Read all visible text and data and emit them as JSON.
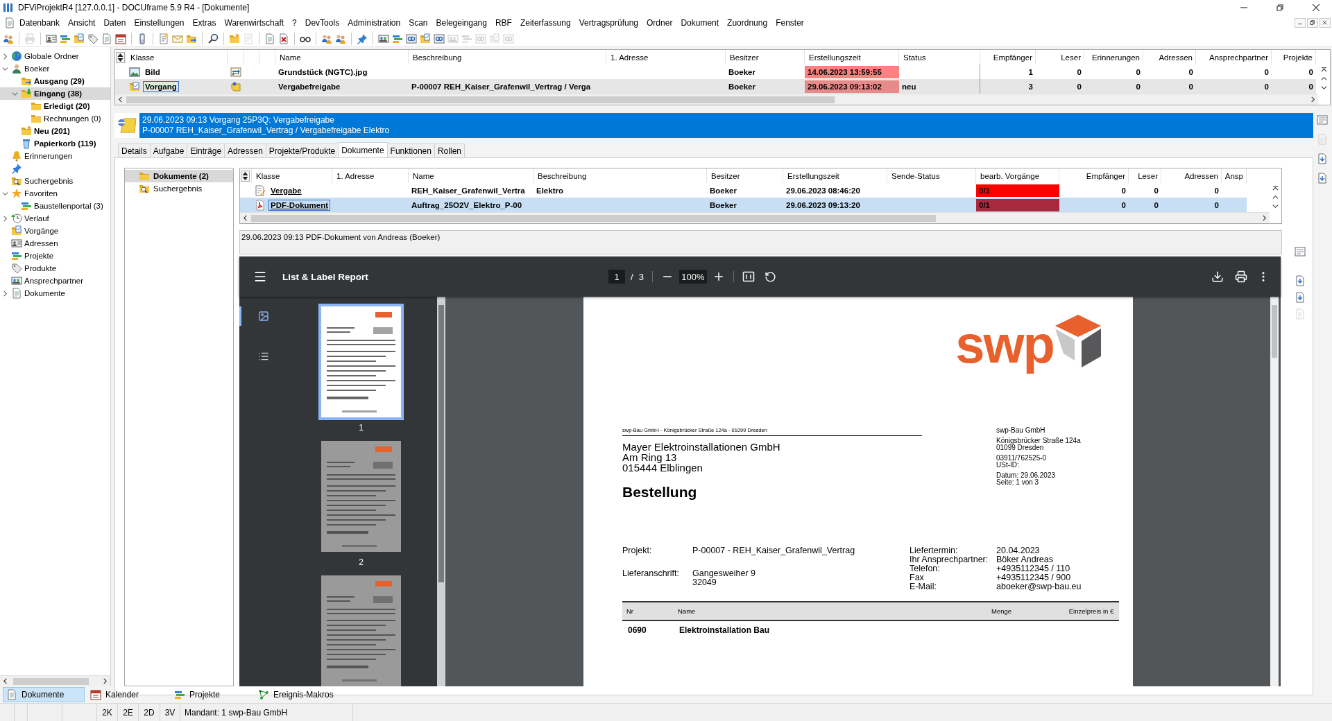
{
  "window": {
    "title": "DFViProjektR4 [127.0.0.1] - DOCUframe 5.9 R4 - [Dokumente]"
  },
  "menu": [
    "Datenbank",
    "Ansicht",
    "Daten",
    "Einstellungen",
    "Extras",
    "Warenwirtschaft",
    "?",
    "DevTools",
    "Administration",
    "Scan",
    "Belegeingang",
    "RBF",
    "Zeiterfassung",
    "Vertragsprüfung",
    "Ordner",
    "Dokument",
    "Zuordnung",
    "Fenster"
  ],
  "toolbar": [
    [
      {
        "kind": "people",
        "disabled": false
      }
    ],
    [
      {
        "kind": "printer",
        "disabled": true
      }
    ],
    [
      {
        "kind": "card",
        "disabled": false
      },
      {
        "kind": "stack",
        "disabled": false
      },
      {
        "kind": "checklist",
        "disabled": false
      },
      {
        "kind": "tag",
        "disabled": false
      },
      {
        "kind": "page",
        "disabled": false
      },
      {
        "kind": "calendar",
        "disabled": false
      }
    ],
    [
      {
        "kind": "phone",
        "disabled": false
      }
    ],
    [
      {
        "kind": "note",
        "disabled": false
      },
      {
        "kind": "envelope",
        "disabled": false
      },
      {
        "kind": "folder-out",
        "disabled": false
      }
    ],
    [
      {
        "kind": "magnifier",
        "disabled": false
      }
    ],
    [
      {
        "kind": "folder-new",
        "disabled": false
      },
      {
        "kind": "note",
        "disabled": true
      }
    ],
    [
      {
        "kind": "page",
        "disabled": false
      },
      {
        "kind": "doc-x",
        "disabled": false
      }
    ],
    [
      {
        "kind": "glasses",
        "disabled": false
      }
    ],
    [
      {
        "kind": "people",
        "disabled": false
      },
      {
        "kind": "people",
        "disabled": false
      }
    ],
    [
      {
        "kind": "pin",
        "disabled": false
      }
    ],
    [
      {
        "kind": "contacts",
        "disabled": false
      },
      {
        "kind": "stack",
        "disabled": false
      },
      {
        "kind": "link",
        "disabled": false
      },
      {
        "kind": "checklist",
        "disabled": false
      },
      {
        "kind": "link",
        "disabled": false
      },
      {
        "kind": "contacts",
        "disabled": true
      },
      {
        "kind": "stack",
        "disabled": true
      },
      {
        "kind": "link",
        "disabled": true
      },
      {
        "kind": "checklist",
        "disabled": true
      },
      {
        "kind": "link",
        "disabled": true
      }
    ]
  ],
  "tree": [
    {
      "label": "Globale Ordner",
      "kind": "globe",
      "expanded": false,
      "selected": false,
      "unread": false
    },
    {
      "label": "Boeker",
      "kind": "person",
      "expanded": true,
      "selected": false,
      "unread": false,
      "children": [
        {
          "label": "Ausgang (29)",
          "kind": "folder-out",
          "selected": false,
          "unread": true
        },
        {
          "label": "Eingang (38)",
          "kind": "folder-in",
          "expanded": true,
          "selected": true,
          "unread": true,
          "children": [
            {
              "label": "Erledigt (20)",
              "kind": "folder",
              "selected": false,
              "unread": true
            },
            {
              "label": "Rechnungen (0)",
              "kind": "folder",
              "selected": false,
              "unread": false
            }
          ]
        },
        {
          "label": "Neu (201)",
          "kind": "folder-new",
          "selected": false,
          "unread": true
        },
        {
          "label": "Papierkorb (119)",
          "kind": "bin",
          "selected": false,
          "unread": true
        }
      ]
    },
    {
      "label": "Erinnerungen",
      "kind": "bell",
      "selected": false,
      "unread": false
    },
    {
      "kind": "pin",
      "selected": false
    },
    {
      "label": "Suchergebnis",
      "kind": "search-folder",
      "selected": false,
      "unread": false
    },
    {
      "label": "Favoriten",
      "kind": "star",
      "expanded": true,
      "selected": false,
      "unread": false,
      "children": [
        {
          "label": "Baustellenportal (3)",
          "kind": "stack",
          "selected": false,
          "unread": false
        }
      ]
    },
    {
      "label": "Verlauf",
      "kind": "clock",
      "expanded": false,
      "selected": false,
      "unread": false
    },
    {
      "label": "Vorgänge",
      "kind": "checklist",
      "selected": false,
      "unread": false
    },
    {
      "label": "Adressen",
      "kind": "card",
      "selected": false,
      "unread": false
    },
    {
      "label": "Projekte",
      "kind": "stack",
      "selected": false,
      "unread": false
    },
    {
      "label": "Produkte",
      "kind": "tag",
      "selected": false,
      "unread": false
    },
    {
      "label": "Ansprechpartner",
      "kind": "contacts",
      "selected": false,
      "unread": false
    },
    {
      "label": "Dokumente",
      "kind": "page",
      "expanded": false,
      "selected": false,
      "unread": false
    }
  ],
  "items_table": {
    "columns": [
      {
        "label": "Klasse",
        "kind": "class"
      },
      {
        "label": "Name",
        "kind": "text"
      },
      {
        "label": "Beschreibung",
        "kind": "text"
      },
      {
        "label": "1. Adresse",
        "kind": "text"
      },
      {
        "label": "Besitzer",
        "kind": "text"
      },
      {
        "label": "Erstellungszeit",
        "kind": "alert"
      },
      {
        "label": "Status",
        "kind": "text"
      },
      {
        "label": "Empfänger",
        "kind": "number"
      },
      {
        "label": "Leser",
        "kind": "number"
      },
      {
        "label": "Erinnerungen",
        "kind": "number"
      },
      {
        "label": "Adressen",
        "kind": "number"
      },
      {
        "label": "Ansprechpartner",
        "kind": "number"
      },
      {
        "label": "Projekte",
        "kind": "number"
      }
    ],
    "rows": [
      {
        "selected": false,
        "kind": "image",
        "overdue": true,
        "cells": [
          "Bild",
          "Grundstück (NGTC).jpg",
          null,
          null,
          "Boeker",
          "14.06.2023 13:59:55",
          null,
          "1",
          "0",
          "0",
          "0",
          "0",
          "0"
        ]
      },
      {
        "selected": true,
        "kind": "task",
        "overdue": true,
        "cells": [
          "Vorgang",
          "Vergabefreigabe",
          "P-00007 REH_Kaiser_Grafenwil_Vertrag / Verga",
          null,
          "Boeker",
          "29.06.2023 09:13:02",
          "neu",
          "3",
          "0",
          "0",
          "0",
          "0",
          "0"
        ]
      }
    ]
  },
  "banner": {
    "lines": [
      "29.06.2023 09:13 Vorgang 25P3Q: Vergabefreigabe",
      "P-00007 REH_Kaiser_Grafenwil_Vertrag / Vergabefreigabe Elektro"
    ]
  },
  "tabs": [
    {
      "label": "Details",
      "selected": false
    },
    {
      "label": "Aufgabe",
      "selected": false
    },
    {
      "label": "Einträge",
      "selected": false
    },
    {
      "label": "Adressen",
      "selected": false
    },
    {
      "label": "Projekte/Produkte",
      "selected": false
    },
    {
      "label": "Dokumente",
      "selected": true
    },
    {
      "label": "Funktionen",
      "selected": false
    },
    {
      "label": "Rollen",
      "selected": false
    }
  ],
  "document_folders": [
    {
      "label": "Dokumente (2)",
      "kind": "folder",
      "selected": true,
      "unread": true
    },
    {
      "label": "Suchergebnis",
      "kind": "search-folder",
      "selected": false,
      "unread": false
    }
  ],
  "documents_table": {
    "columns": [
      {
        "label": "Klasse",
        "kind": "class"
      },
      {
        "label": "1. Adresse",
        "kind": "text"
      },
      {
        "label": "Name",
        "kind": "text"
      },
      {
        "label": "Beschreibung",
        "kind": "text"
      },
      {
        "label": "Besitzer",
        "kind": "text"
      },
      {
        "label": "Erstellungszeit",
        "kind": "text"
      },
      {
        "label": "Sende-Status",
        "kind": "text"
      },
      {
        "label": "bearb. Vorgänge",
        "kind": "alert"
      },
      {
        "label": "Empfänger",
        "kind": "number"
      },
      {
        "label": "Leser",
        "kind": "number"
      },
      {
        "label": "Adressen",
        "kind": "number"
      },
      {
        "label": "Ansp",
        "kind": "number"
      }
    ],
    "rows": [
      {
        "selected": false,
        "kind": "edit",
        "overdue": true,
        "cells": [
          "Vergabe",
          null,
          "REH_Kaiser_Grafenwil_Vertra",
          "Elektro",
          "Boeker",
          "29.06.2023 08:46:20",
          null,
          "0/1",
          "0",
          "0",
          "0",
          null
        ]
      },
      {
        "selected": true,
        "kind": "pdf",
        "overdue": true,
        "cells": [
          "PDF-Dokument",
          null,
          "Auftrag_25O2V_Elektro_P-00",
          null,
          "Boeker",
          "29.06.2023 09:13:20",
          null,
          "0/1",
          "0",
          "0",
          "0",
          null
        ]
      }
    ]
  },
  "document_info": "29.06.2023 09:13 PDF-Dokument von Andreas (Boeker)",
  "viewer": {
    "title": "List & Label Report",
    "page": "1",
    "page_separator": "/",
    "page_count": "3",
    "zoom": "100%",
    "sidebar_views": [
      {
        "kind": "thumbnails",
        "selected": true
      },
      {
        "kind": "outline",
        "selected": false
      }
    ],
    "thumbnails": [
      {
        "label": "1",
        "selected": true
      },
      {
        "label": "2",
        "selected": false
      },
      {
        "selected": false
      }
    ],
    "document": {
      "logo": "swp",
      "sender_line": "swp-Bau GmbH - Königsbrücker Straße 124a - 01099 Dresden",
      "recipient": [
        "Mayer Elektroinstallationen GmbH",
        "Am Ring 13",
        "015444 Elblingen"
      ],
      "heading": "Bestellung",
      "sender_blocks": [
        [
          "swp-Bau GmbH"
        ],
        [
          "Königsbrücker Straße 124a",
          "01099 Dresden"
        ],
        [
          "03911/762525-0",
          "USt-ID:"
        ],
        [
          "Datum: 29.06.2023",
          "Seite: 1 von 3"
        ]
      ],
      "details_left": [
        {
          "label": "Projekt:",
          "value": [
            "P-00007 - REH_Kaiser_Grafenwil_Vertrag"
          ]
        },
        {
          "label": "Lieferanschrift:",
          "value": [
            "Gangesweiher 9",
            "32049"
          ]
        }
      ],
      "details_right": [
        {
          "label": "Liefertermin:",
          "value": "20.04.2023"
        },
        {
          "label": "Ihr Ansprechpartner:",
          "value": "Böker Andreas"
        },
        {
          "label": "Telefon:",
          "value": "+4935112345 / 110"
        },
        {
          "label": "Fax",
          "value": "+4935112345 / 900"
        },
        {
          "label": "E-Mail:",
          "value": "aboeker@swp-bau.eu"
        }
      ],
      "table_columns": [
        "Nr",
        "Name",
        "Menge",
        "Einzelpreis in €"
      ],
      "table_rows": [
        [
          "0690",
          "Elektroinstallation Bau"
        ]
      ]
    }
  },
  "bottom_tabs": [
    {
      "label": "Dokumente",
      "kind": "page",
      "selected": true
    },
    {
      "label": "Kalender",
      "kind": "calendar",
      "selected": false
    },
    {
      "label": "Projekte",
      "kind": "stack",
      "selected": false
    },
    {
      "label": "Ereignis-Makros",
      "kind": "macro",
      "selected": false
    }
  ],
  "status_bar": [
    "2K",
    "2E",
    "2D",
    "3V",
    "Mandant: 1 swp-Bau GmbH"
  ]
}
